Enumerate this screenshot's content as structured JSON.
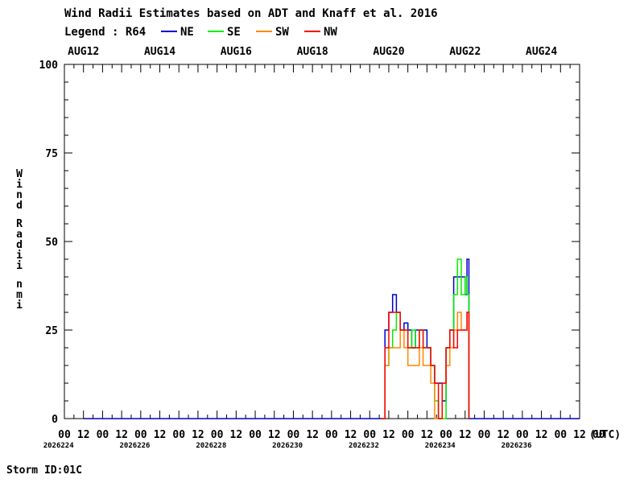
{
  "chart_data": {
    "type": "line",
    "title": "Wind Radii Estimates based on ADT and Knaff et al. 2016",
    "legend_label": "Legend : R64",
    "ylabel": "Wind Radii nmi",
    "xlabel_unit": "(UTC)",
    "ylim": [
      0,
      100
    ],
    "yticks": [
      0,
      25,
      50,
      75,
      100
    ],
    "grid": false,
    "legend_position": "top",
    "top_date_labels": [
      "AUG12",
      "AUG14",
      "AUG16",
      "AUG18",
      "AUG20",
      "AUG22",
      "AUG24"
    ],
    "bottom_hour_labels": [
      "00",
      "12",
      "00",
      "12",
      "00",
      "12",
      "00",
      "12",
      "00",
      "12",
      "00",
      "12",
      "00",
      "12",
      "00",
      "12",
      "00",
      "12",
      "00",
      "12",
      "00",
      "12",
      "00",
      "12",
      "00",
      "12",
      "00",
      "12",
      "00"
    ],
    "bottom_julian_labels": [
      "2026224",
      "2026226",
      "2026228",
      "2026230",
      "2026232",
      "2026234",
      "2026236"
    ],
    "footer": "Storm ID:01C",
    "x_units": "day_of_august",
    "xlim": [
      11.5,
      25.0
    ],
    "series": [
      {
        "name": "NE",
        "color": "#0000cc",
        "x": [
          12.0,
          19.8,
          19.9,
          20.0,
          20.1,
          20.2,
          20.3,
          20.4,
          20.5,
          20.6,
          20.7,
          20.8,
          20.9,
          21.0,
          21.1,
          21.2,
          21.3,
          21.4,
          21.5,
          21.6,
          21.7,
          21.8,
          21.9,
          22.0,
          22.05,
          22.1,
          22.5,
          25.0
        ],
        "y": [
          0,
          0,
          25,
          30,
          35,
          30,
          25,
          27,
          25,
          20,
          25,
          25,
          25,
          20,
          15,
          10,
          10,
          5,
          20,
          25,
          40,
          40,
          40,
          35,
          45,
          0,
          0,
          0
        ]
      },
      {
        "name": "SE",
        "color": "#00ee00",
        "x": [
          19.8,
          19.9,
          20.0,
          20.1,
          20.2,
          20.3,
          20.4,
          20.5,
          20.6,
          20.7,
          20.8,
          20.9,
          21.0,
          21.1,
          21.2,
          21.3,
          21.4,
          21.5,
          21.6,
          21.7,
          21.8,
          21.9,
          22.0,
          22.05,
          22.1
        ],
        "y": [
          0,
          15,
          20,
          25,
          30,
          25,
          25,
          20,
          25,
          20,
          25,
          20,
          20,
          15,
          5,
          0,
          0,
          20,
          25,
          35,
          45,
          35,
          40,
          35,
          0
        ]
      },
      {
        "name": "SW",
        "color": "#ff8800",
        "x": [
          19.8,
          19.9,
          20.0,
          20.1,
          20.2,
          20.3,
          20.4,
          20.5,
          20.6,
          20.7,
          20.8,
          20.9,
          21.0,
          21.1,
          21.2,
          21.3,
          21.4,
          21.5,
          21.6,
          21.7,
          21.8,
          21.9,
          22.0,
          22.05,
          22.1
        ],
        "y": [
          0,
          15,
          20,
          20,
          20,
          25,
          20,
          15,
          15,
          15,
          20,
          15,
          15,
          10,
          0,
          0,
          10,
          15,
          20,
          25,
          30,
          25,
          25,
          30,
          0
        ]
      },
      {
        "name": "NW",
        "color": "#ff0000",
        "x": [
          19.8,
          19.9,
          20.0,
          20.1,
          20.2,
          20.3,
          20.4,
          20.5,
          20.6,
          20.7,
          20.8,
          20.9,
          21.0,
          21.1,
          21.2,
          21.3,
          21.4,
          21.5,
          21.6,
          21.7,
          21.8,
          21.9,
          22.0,
          22.05,
          22.1
        ],
        "y": [
          0,
          20,
          30,
          30,
          30,
          25,
          25,
          20,
          20,
          20,
          25,
          20,
          20,
          15,
          10,
          0,
          10,
          20,
          25,
          20,
          25,
          25,
          25,
          30,
          0
        ]
      }
    ]
  }
}
